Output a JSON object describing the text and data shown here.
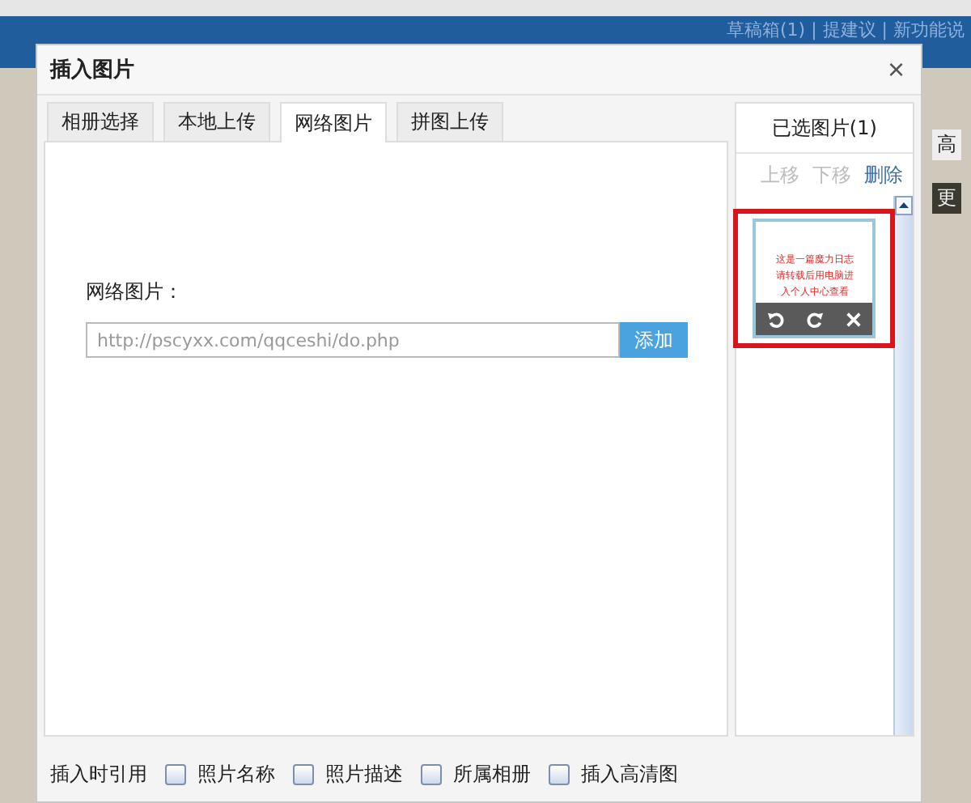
{
  "background": {
    "header_links": "草稿箱(1) | 提建议 | 新功能说",
    "side_labels": [
      "高",
      "更"
    ]
  },
  "window": {
    "title": "插入图片",
    "close": "×"
  },
  "tabs": [
    {
      "label": "相册选择",
      "selected": false
    },
    {
      "label": "本地上传",
      "selected": false
    },
    {
      "label": "网络图片",
      "selected": true
    },
    {
      "label": "拼图上传",
      "selected": false
    }
  ],
  "url_form": {
    "label": "网络图片：",
    "value": "http://pscyxx.com/qqceshi/do.php",
    "button": "添加"
  },
  "selected_panel": {
    "title": "已选图片(1)",
    "actions": [
      {
        "label": "上移",
        "disabled": true
      },
      {
        "label": "下移",
        "disabled": true
      },
      {
        "label": "删除",
        "disabled": false
      }
    ],
    "thumbnail": {
      "lines": [
        "这是一篇魔力日志",
        "请转载后用电脑进",
        "入个人中心查看"
      ],
      "highlighted": true
    }
  },
  "options": {
    "label": "插入时引用",
    "checkboxes": [
      {
        "label": "照片名称",
        "checked": false
      },
      {
        "label": "照片描述",
        "checked": false
      },
      {
        "label": "所属相册",
        "checked": false
      },
      {
        "label": "插入高清图",
        "checked": false
      }
    ]
  }
}
